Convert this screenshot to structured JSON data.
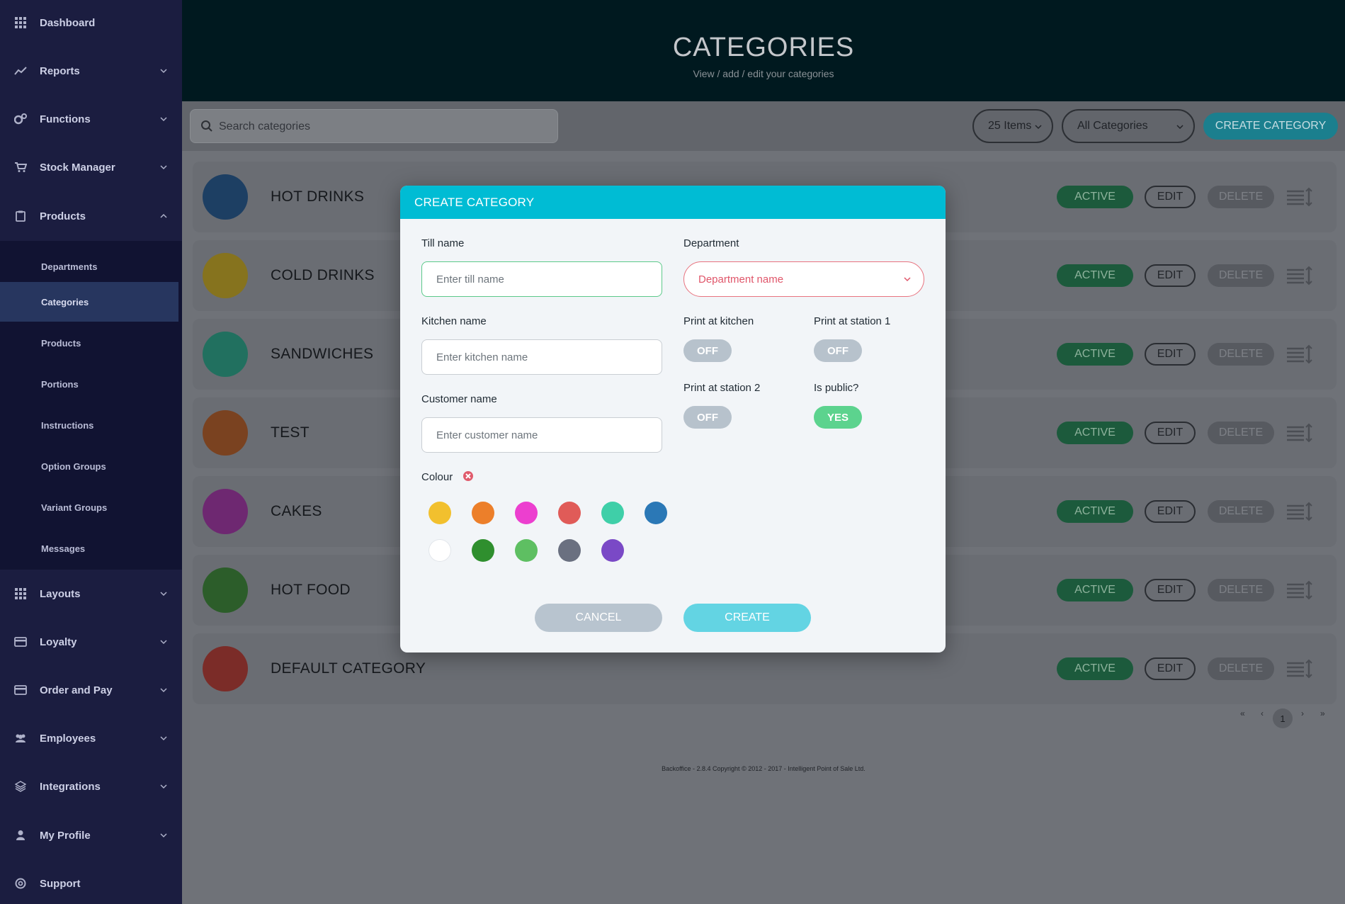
{
  "sidebar": {
    "items": [
      {
        "label": "Dashboard",
        "icon": "grid-icon"
      },
      {
        "label": "Reports",
        "icon": "chart-icon"
      },
      {
        "label": "Functions",
        "icon": "cogs-icon"
      },
      {
        "label": "Stock Manager",
        "icon": "cart-icon"
      },
      {
        "label": "Products",
        "icon": "clipboard-icon"
      },
      {
        "label": "Layouts",
        "icon": "grid-icon"
      },
      {
        "label": "Loyalty",
        "icon": "card-icon"
      },
      {
        "label": "Order and Pay",
        "icon": "card-icon"
      },
      {
        "label": "Employees",
        "icon": "users-icon"
      },
      {
        "label": "Integrations",
        "icon": "layers-icon"
      },
      {
        "label": "My Profile",
        "icon": "user-icon"
      },
      {
        "label": "Support",
        "icon": "lifebuoy-icon"
      }
    ],
    "submenu": [
      {
        "label": "Departments"
      },
      {
        "label": "Categories"
      },
      {
        "label": "Products"
      },
      {
        "label": "Portions"
      },
      {
        "label": "Instructions"
      },
      {
        "label": "Option Groups"
      },
      {
        "label": "Variant Groups"
      },
      {
        "label": "Messages"
      }
    ],
    "active_submenu": "Categories"
  },
  "header": {
    "title": "CATEGORIES",
    "subtitle": "View / add / edit your categories"
  },
  "toolbar": {
    "search_placeholder": "Search categories",
    "items_per_page": "25 Items",
    "filter": "All Categories",
    "create_label": "CREATE CATEGORY"
  },
  "rows": [
    {
      "name": "HOT DRINKS",
      "color": "#1d3f63",
      "status": "ACTIVE",
      "edit": "EDIT",
      "delete": "DELETE"
    },
    {
      "name": "COLD DRINKS",
      "color": "#86731e",
      "status": "ACTIVE",
      "edit": "EDIT",
      "delete": "DELETE"
    },
    {
      "name": "SANDWICHES",
      "color": "#21705f",
      "status": "ACTIVE",
      "edit": "EDIT",
      "delete": "DELETE"
    },
    {
      "name": "TEST",
      "color": "#7a4220",
      "status": "ACTIVE",
      "edit": "EDIT",
      "delete": "DELETE"
    },
    {
      "name": "CAKES",
      "color": "#6e2871",
      "status": "ACTIVE",
      "edit": "EDIT",
      "delete": "DELETE"
    },
    {
      "name": "HOT FOOD",
      "color": "#2c5d2a",
      "status": "ACTIVE",
      "edit": "EDIT",
      "delete": "DELETE"
    },
    {
      "name": "DEFAULT CATEGORY",
      "color": "#7b2c28",
      "status": "ACTIVE",
      "edit": "EDIT",
      "delete": "DELETE"
    }
  ],
  "pagination": {
    "first": "«",
    "prev": "‹",
    "current": "1",
    "next": "›",
    "last": "»"
  },
  "footer": {
    "text": "Backoffice - 2.8.4 Copyright © 2012 - 2017 - Intelligent Point of Sale Ltd."
  },
  "modal": {
    "title": "CREATE CATEGORY",
    "till_name_label": "Till name",
    "till_name_placeholder": "Enter till name",
    "kitchen_name_label": "Kitchen name",
    "kitchen_name_placeholder": "Enter kitchen name",
    "customer_name_label": "Customer name",
    "customer_name_placeholder": "Enter customer name",
    "department_label": "Department",
    "department_placeholder": "Department name",
    "print_kitchen_label": "Print at kitchen",
    "print_kitchen_value": "OFF",
    "print_station1_label": "Print at station 1",
    "print_station1_value": "OFF",
    "print_station2_label": "Print at station 2",
    "print_station2_value": "OFF",
    "is_public_label": "Is public?",
    "is_public_value": "YES",
    "colour_label": "Colour",
    "swatches": [
      "#f2c02e",
      "#ec7f2a",
      "#ec3fcf",
      "#e05b58",
      "#3fcfa8",
      "#2b78b6",
      "#ffffff",
      "#2f8f2e",
      "#5ebf62",
      "#6a7080",
      "#7a49c6"
    ],
    "cancel_label": "CANCEL",
    "create_label": "CREATE"
  }
}
